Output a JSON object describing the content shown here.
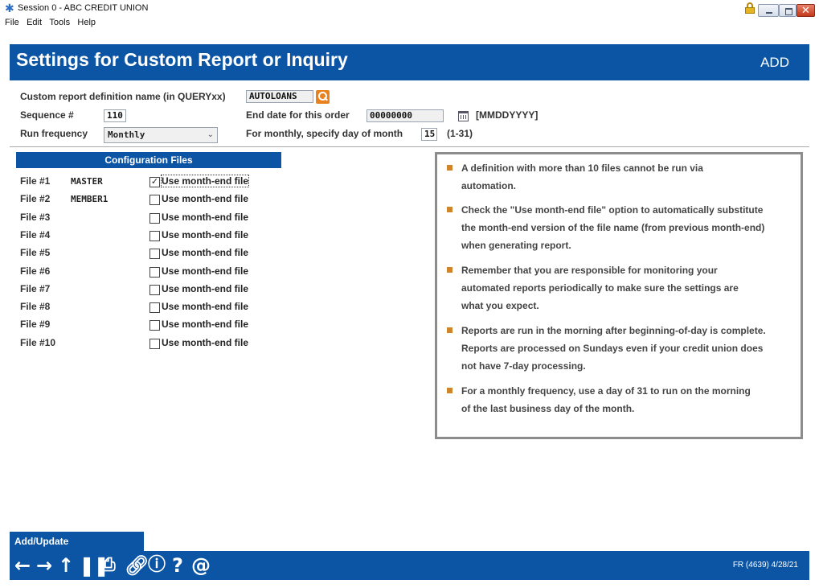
{
  "window": {
    "title": "Session 0 - ABC CREDIT UNION"
  },
  "menu": [
    "File",
    "Edit",
    "Tools",
    "Help"
  ],
  "header": {
    "title": "Settings for Custom Report or Inquiry",
    "mode": "ADD"
  },
  "form": {
    "def_name_label": "Custom report definition name (in QUERYxx)",
    "def_name_value": "AUTOLOANS",
    "sequence_label": "Sequence #",
    "sequence_value": "110",
    "end_date_label": "End date for this order",
    "end_date_value": "00000000",
    "end_date_format": "[MMDDYYYY]",
    "run_freq_label": "Run frequency",
    "run_freq_value": "Monthly",
    "day_of_month_label": "For monthly, specify day of month",
    "day_of_month_value": "15",
    "day_of_month_range": "(1-31)"
  },
  "config": {
    "heading": "Configuration Files",
    "checkbox_label": "Use month-end file",
    "files": [
      {
        "label": "File #1",
        "name": "MASTER",
        "checked": true
      },
      {
        "label": "File #2",
        "name": "MEMBER1",
        "checked": false
      },
      {
        "label": "File #3",
        "name": "",
        "checked": false
      },
      {
        "label": "File #4",
        "name": "",
        "checked": false
      },
      {
        "label": "File #5",
        "name": "",
        "checked": false
      },
      {
        "label": "File #6",
        "name": "",
        "checked": false
      },
      {
        "label": "File #7",
        "name": "",
        "checked": false
      },
      {
        "label": "File #8",
        "name": "",
        "checked": false
      },
      {
        "label": "File #9",
        "name": "",
        "checked": false
      },
      {
        "label": "File #10",
        "name": "",
        "checked": false
      }
    ]
  },
  "info": [
    {
      "lines": [
        "A definition with more than 10 files cannot be run via",
        "automation."
      ]
    },
    {
      "lines": [
        "Check the \"Use month-end file\" option to automatically substitute",
        " the month-end version of the file name (from previous month-end)",
        "when generating report."
      ]
    },
    {
      "lines": [
        "Remember that you are responsible for monitoring your",
        "automated reports periodically to make sure the settings are",
        "what you expect."
      ]
    },
    {
      "lines": [
        "Reports are run in the morning after beginning-of-day is complete.",
        "Reports are processed on Sundays even if your credit union does",
        "not have 7-day processing."
      ]
    },
    {
      "lines": [
        "For a monthly frequency, use a day of 31 to run on the morning",
        "of the last business day of the month."
      ]
    }
  ],
  "actions": {
    "add_update": "Add/Update"
  },
  "footer": {
    "stamp": "FR (4639) 4/28/21"
  },
  "colors": {
    "brand_blue": "#0c55a5",
    "bullet_orange": "#d1852a"
  }
}
